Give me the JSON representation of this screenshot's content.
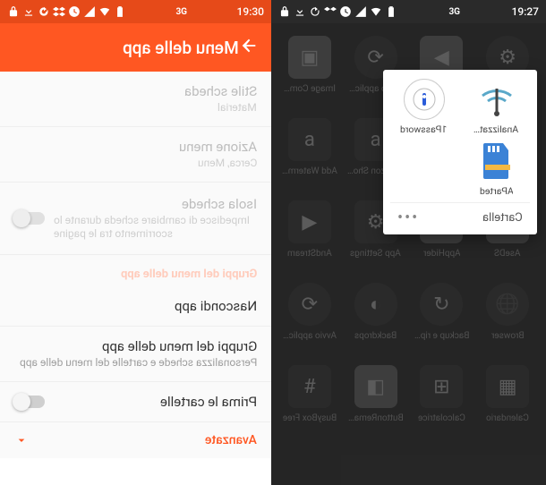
{
  "left": {
    "status": {
      "time": "19:30",
      "net": "3G"
    },
    "appbar": {
      "title": "Menu delle app"
    },
    "rows": {
      "stile": {
        "title": "Stile scheda",
        "sub": "Material"
      },
      "azione": {
        "title": "Azione menu",
        "sub": "Cerca, Menu"
      },
      "isola": {
        "title": "Isola schede",
        "sub": "Impedisce di cambiare scheda durante lo scorrimento tra le pagine"
      },
      "nascondi": {
        "title": "Nascondi app"
      },
      "gruppi": {
        "title": "Gruppi del menu delle app",
        "sub": "Personalizza schede e cartelle del menu delle app"
      },
      "prima": {
        "title": "Prima le cartelle"
      }
    },
    "sections": {
      "gruppi": "Gruppi del menu delle app",
      "avanzate": "Avanzate"
    }
  },
  "right": {
    "status": {
      "time": "19:27",
      "net": "3G"
    },
    "popup": {
      "items": {
        "p0": "1Password",
        "p1": "Analizzat…",
        "p2": "AParted"
      },
      "footer_label": "Cartella"
    },
    "apps": {
      "a0": "Image Com…",
      "a1": "Avvio applic…",
      "a2": "",
      "a3": "",
      "a4": "Add Waterm…",
      "a5": "Amazon Sho…",
      "a6": "",
      "a7": "",
      "a8": "AndStream",
      "a9": "App Settings",
      "a10": "AppHider",
      "a11": "AseDS",
      "a12": "Avvio applic…",
      "a13": "Backdrops",
      "a14": "Backup e rip…",
      "a15": "Browser",
      "a16": "BusyBox Free",
      "a17": "ButtonRema…",
      "a18": "Calcolatrice",
      "a19": "Calendario"
    }
  }
}
